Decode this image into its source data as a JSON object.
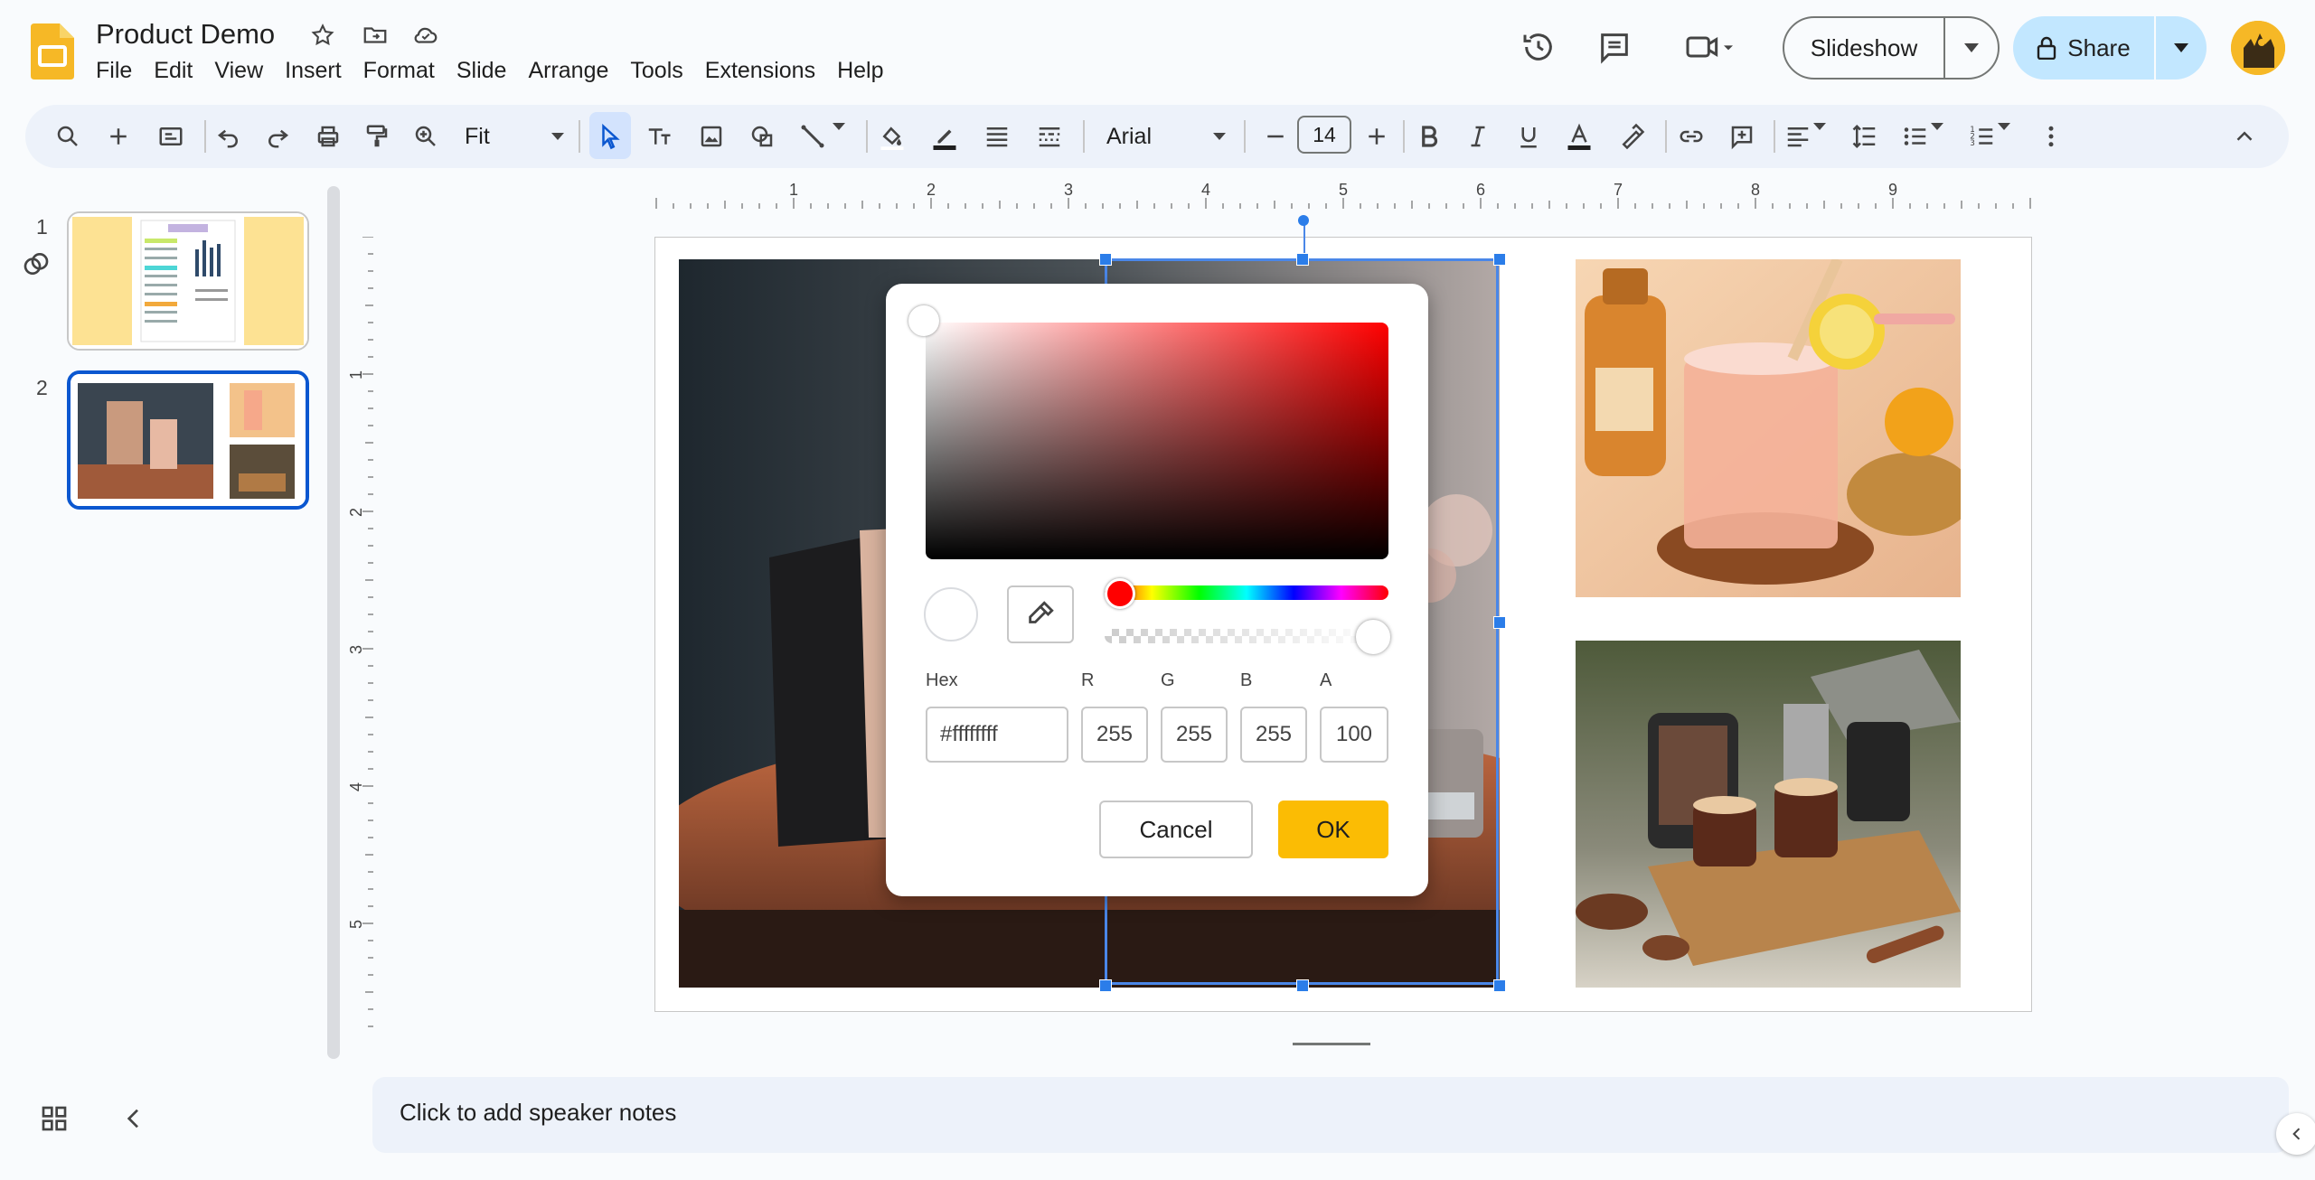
{
  "app": {
    "doc_title": "Product Demo",
    "menu": [
      "File",
      "Edit",
      "View",
      "Insert",
      "Format",
      "Slide",
      "Arrange",
      "Tools",
      "Extensions",
      "Help"
    ],
    "slideshow_label": "Slideshow",
    "share_label": "Share",
    "accent": "#0b57d0",
    "logo_color": "#f6b826"
  },
  "toolbar": {
    "zoom": "Fit",
    "font_family": "Arial",
    "font_size": "14"
  },
  "filmstrip": {
    "slides": [
      {
        "number": "1"
      },
      {
        "number": "2"
      }
    ]
  },
  "color_dialog": {
    "hex_label": "Hex",
    "hex_value": "#ffffffff",
    "r_label": "R",
    "r_value": "255",
    "g_label": "G",
    "g_value": "255",
    "b_label": "B",
    "b_value": "255",
    "a_label": "A",
    "a_value": "100",
    "cancel_label": "Cancel",
    "ok_label": "OK",
    "hue_color": "#ff0000"
  },
  "ruler": {
    "h_ticks": [
      "1",
      "2",
      "3",
      "4",
      "5",
      "6",
      "7",
      "8",
      "9"
    ],
    "v_ticks": [
      "1",
      "2",
      "3",
      "4",
      "5"
    ]
  },
  "notes": {
    "placeholder": "Click to add speaker notes"
  }
}
